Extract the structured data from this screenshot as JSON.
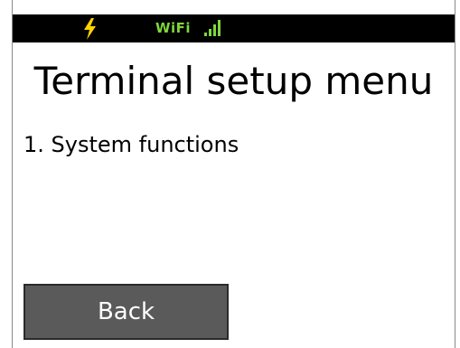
{
  "status_bar": {
    "charging_icon": "lightning-bolt-icon",
    "wifi_label": "WiFi",
    "signal_icon": "signal-bars-icon",
    "colors": {
      "background": "#000000",
      "bolt": "#ffd200",
      "wifi": "#7fd63a"
    }
  },
  "header": {
    "title": "Terminal setup menu"
  },
  "menu": {
    "items": [
      {
        "label": "1. System functions"
      }
    ]
  },
  "footer": {
    "back_label": "Back",
    "back_color": "#5a5a5a"
  }
}
